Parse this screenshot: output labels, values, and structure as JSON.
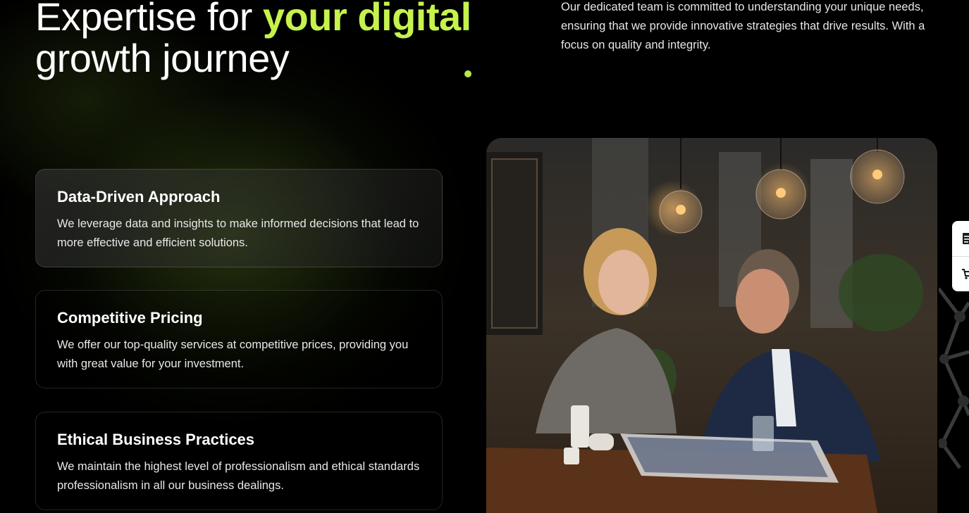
{
  "hero": {
    "title_part1": "Expertise for ",
    "title_accent": "your digital",
    "title_part2": "growth journey",
    "intro": "Our dedicated team is committed to understanding your unique needs, ensuring that we provide innovative strategies that drive results. With a focus on quality and integrity."
  },
  "features": [
    {
      "title": "Data-Driven Approach",
      "description": "We leverage data and insights to make informed decisions that lead to more effective and efficient solutions."
    },
    {
      "title": "Competitive Pricing",
      "description": "We offer our top-quality services at competitive prices, providing you with great value for your investment."
    },
    {
      "title": "Ethical Business Practices",
      "description": "We maintain the highest level of professionalism and ethical standards professionalism in all our business dealings."
    }
  ],
  "colors": {
    "accent": "#c6f24e",
    "background": "#000000",
    "card_border": "#2a2a2a"
  },
  "icons": {
    "side_top": "document-icon",
    "side_bottom": "cart-icon"
  }
}
